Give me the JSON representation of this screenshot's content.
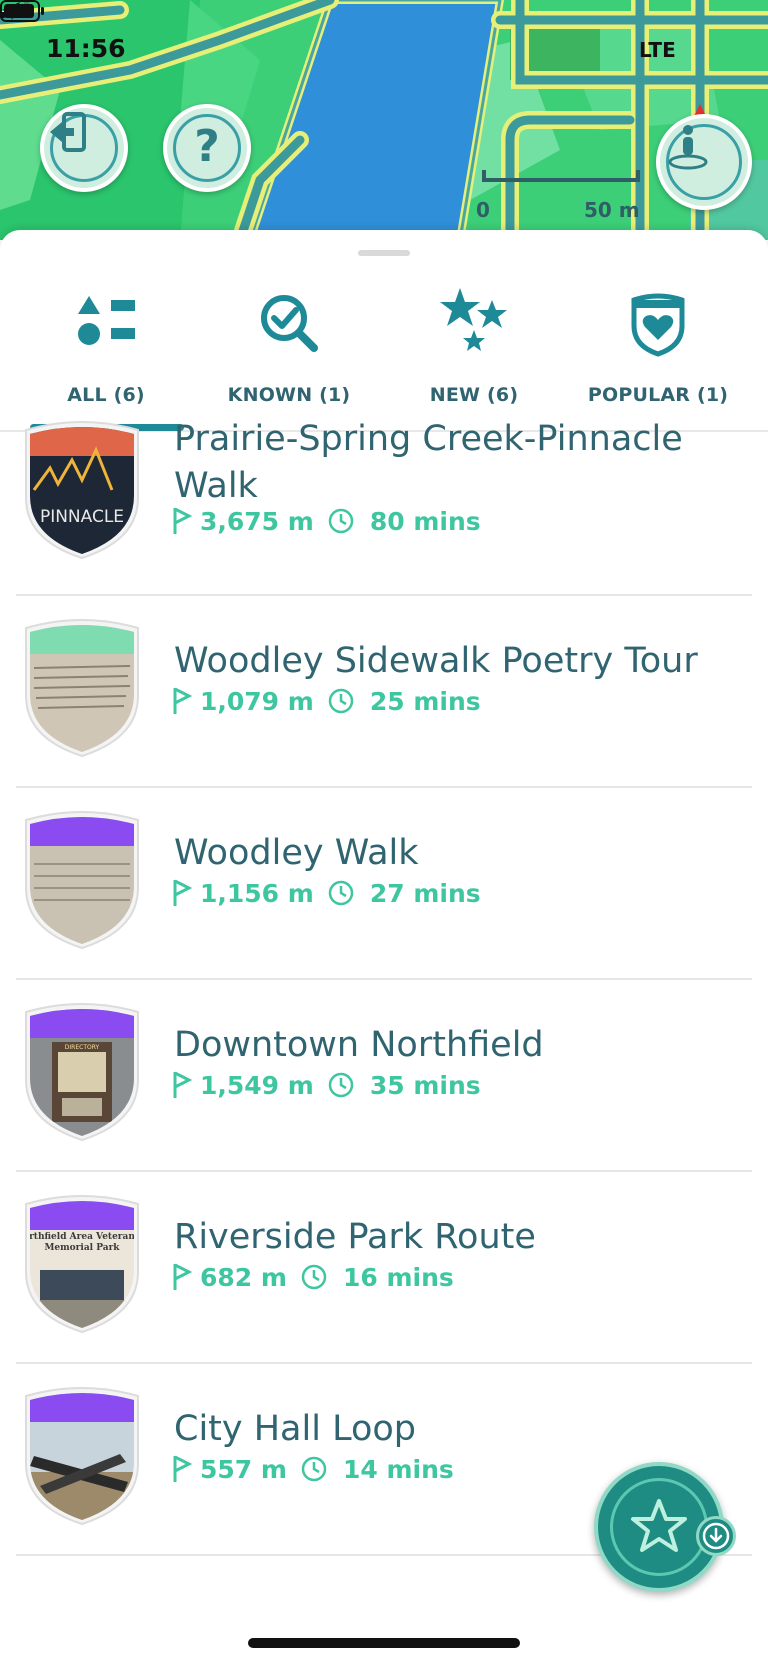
{
  "status_bar": {
    "time": "11:56",
    "network": "LTE"
  },
  "map": {
    "scale_start": "0",
    "scale_end": "50 m",
    "buttons": {
      "exit_icon": "exit-door-icon",
      "help_label": "?",
      "player_icon": "player-location-icon"
    }
  },
  "tabs": [
    {
      "label": "ALL (6)",
      "icon": "shapes-icon",
      "selected": true
    },
    {
      "label": "KNOWN (1)",
      "icon": "search-check-icon",
      "selected": false
    },
    {
      "label": "NEW (6)",
      "icon": "stars-icon",
      "selected": false
    },
    {
      "label": "POPULAR (1)",
      "icon": "heart-shield-icon",
      "selected": false
    }
  ],
  "routes": [
    {
      "title": "Prairie-Spring Creek-Pinnacle Walk",
      "distance": "3,675 m",
      "duration": "80 mins",
      "badge_color": "#e06a4a",
      "thumb_text": "PINNACLE"
    },
    {
      "title": "Woodley Sidewalk Poetry Tour",
      "distance": "1,079 m",
      "duration": "25 mins",
      "badge_color": "#7fdcb0",
      "thumb_text": ""
    },
    {
      "title": "Woodley Walk",
      "distance": "1,156 m",
      "duration": "27 mins",
      "badge_color": "#8a4cf0",
      "thumb_text": ""
    },
    {
      "title": "Downtown Northfield",
      "distance": "1,549 m",
      "duration": "35 mins",
      "badge_color": "#8a4cf0",
      "thumb_text": "DIRECTORY"
    },
    {
      "title": "Riverside Park Route",
      "distance": "682 m",
      "duration": "16 mins",
      "badge_color": "#8a4cf0",
      "thumb_text": "rthfield Area Veteran Memorial Park"
    },
    {
      "title": "City Hall Loop",
      "distance": "557 m",
      "duration": "14 mins",
      "badge_color": "#8a4cf0",
      "thumb_text": ""
    }
  ],
  "fab": {
    "icon": "star-download-icon"
  },
  "colors": {
    "teal_text": "#2f6470",
    "mint_meta": "#3dc6a0",
    "accent": "#1e8a98"
  }
}
